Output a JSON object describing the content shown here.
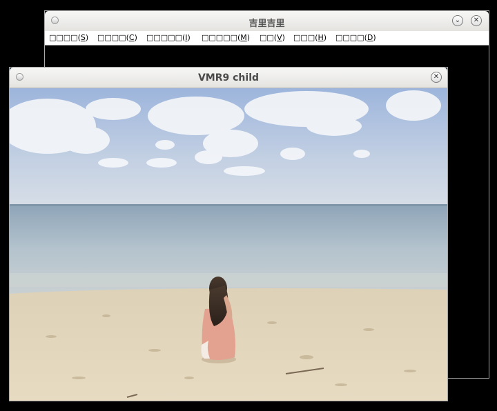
{
  "main_window": {
    "title": "吉里吉里",
    "buttons": {
      "minimize_icon": "chevron-down-icon",
      "close_icon": "close-icon"
    },
    "menu": [
      {
        "label": "□□□□(S)",
        "text": "□□□□(",
        "key": "S"
      },
      {
        "label": "□□□□(C)",
        "text": "□□□□(",
        "key": "C"
      },
      {
        "label": "□□□□□(I)",
        "text": "□□□□□(",
        "key": "I"
      },
      {
        "label": "□□□□□(M)",
        "text": "□□□□□(",
        "key": "M"
      },
      {
        "label": "□□(V)",
        "text": "□□(",
        "key": "V"
      },
      {
        "label": "□□□(H)",
        "text": "□□□(",
        "key": "H"
      },
      {
        "label": "□□□□(D)",
        "text": "□□□□(",
        "key": "D"
      }
    ]
  },
  "child_window": {
    "title": "VMR9 child",
    "close_icon": "close-icon",
    "video_content": "beach-video-frame"
  },
  "colors": {
    "sky_top": "#a9bfe0",
    "sea": "#b2c3cf",
    "sand": "#e3d6b9",
    "dress": "#e3a18f"
  }
}
